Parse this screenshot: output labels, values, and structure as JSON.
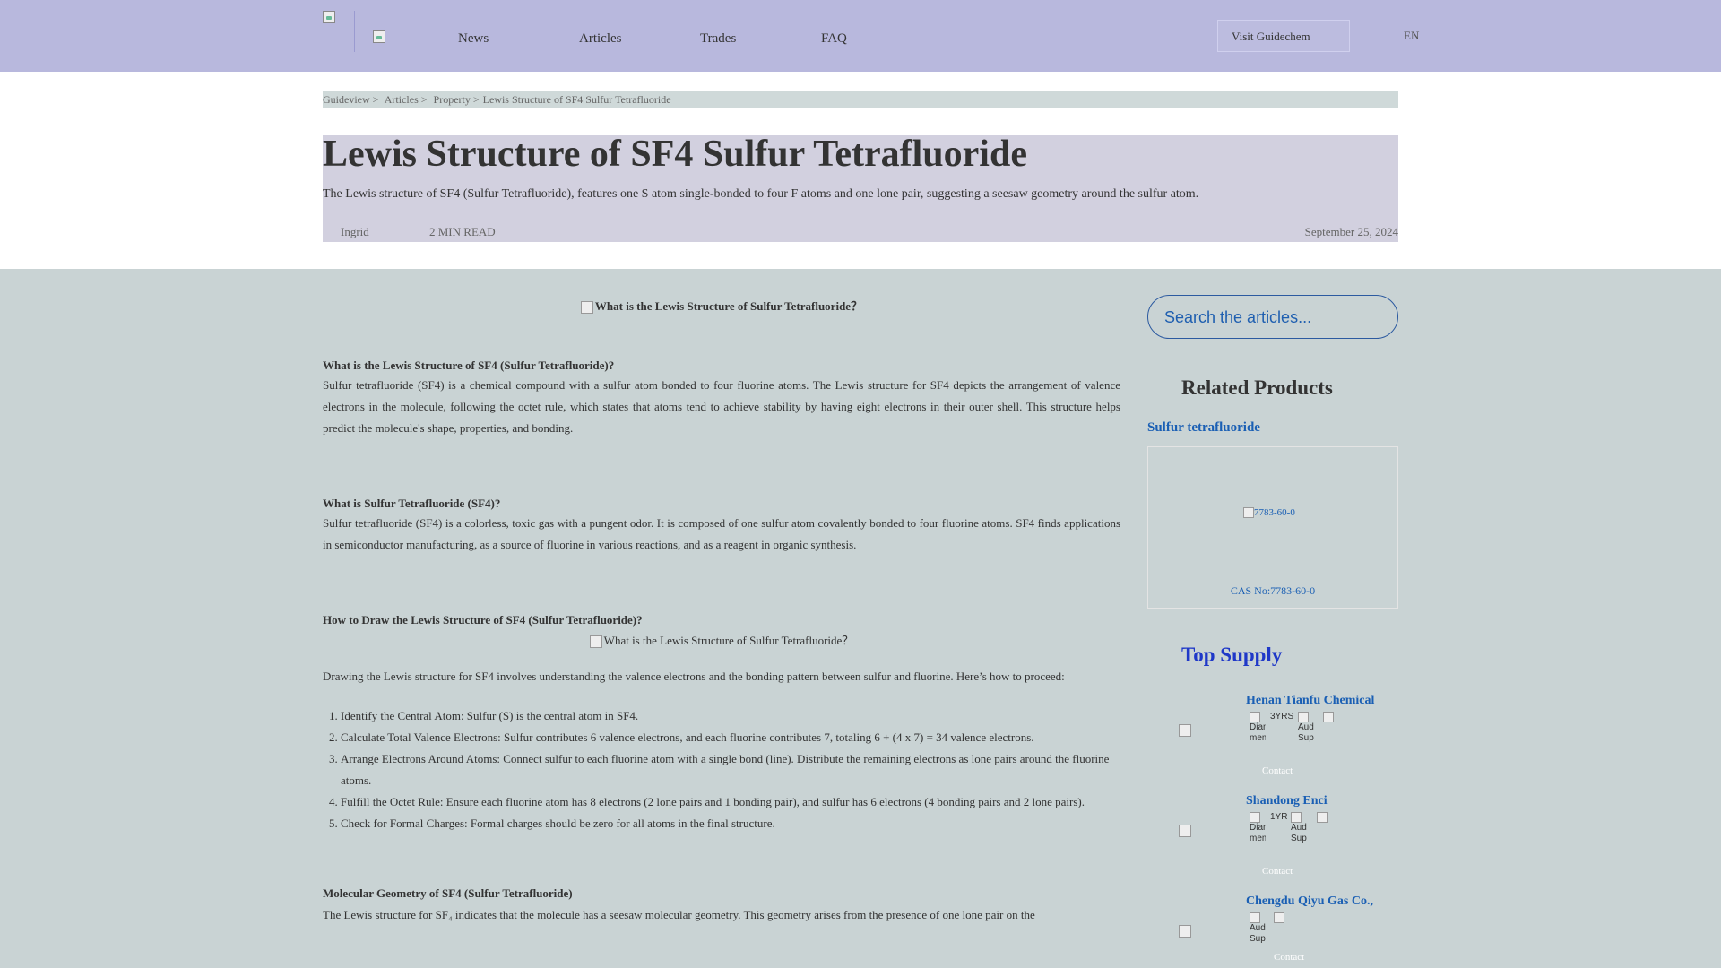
{
  "header": {
    "nav": [
      "News",
      "Articles",
      "Trades",
      "FAQ"
    ],
    "visit_label": "Visit Guidechem",
    "lang": "EN"
  },
  "breadcrumb": [
    "Guideview >",
    "Articles >",
    "Property >",
    "Lewis Structure of SF4 Sulfur Tetrafluoride"
  ],
  "article_head": {
    "title": "Lewis Structure of SF4 Sulfur Tetrafluoride",
    "summary": "The Lewis structure of SF4 (Sulfur Tetrafluoride), features one S atom single-bonded to four F atoms and one lone pair, suggesting a seesaw geometry around the sulfur atom.",
    "author": "Ingrid",
    "read_time": "2 MIN READ",
    "date": "September 25, 2024"
  },
  "article": {
    "img1_alt": "What is the Lewis Structure of Sulfur Tetrafluoride？",
    "s1_heading": "What is the Lewis Structure of SF4 (Sulfur Tetrafluoride)?",
    "s1_para": "Sulfur tetrafluoride (SF4) is a chemical compound with a sulfur atom bonded to four fluorine atoms. The Lewis structure for SF4 depicts the arrangement of valence electrons in the molecule, following the octet rule, which states that atoms tend to achieve stability by having eight electrons in their outer shell. This structure helps predict the molecule's shape, properties, and bonding.",
    "s2_heading": "What is Sulfur Tetrafluoride (SF4)?",
    "s2_para": "Sulfur tetrafluoride (SF4) is a colorless, toxic gas with a pungent odor. It is composed of one sulfur atom covalently bonded to four fluorine atoms. SF4 finds applications in semiconductor manufacturing, as a source of fluorine in various reactions, and as a reagent in organic synthesis.",
    "s3_heading": "How to Draw the Lewis Structure of SF4 (Sulfur Tetrafluoride)?",
    "img2_alt": "What is the Lewis Structure of Sulfur Tetrafluoride？",
    "s3_para": "Drawing the Lewis structure for SF4 involves understanding the valence electrons and the bonding pattern between sulfur and fluorine. Here’s how to proceed:",
    "steps": [
      "Identify the Central Atom: Sulfur (S) is the central atom in SF4.",
      "Calculate Total Valence Electrons: Sulfur contributes 6 valence electrons, and each fluorine contributes 7, totaling 6 + (4 x 7) = 34 valence electrons.",
      "Arrange Electrons Around Atoms: Connect sulfur to each fluorine atom with a single bond (line). Distribute the remaining electrons as lone pairs around the fluorine atoms.",
      "Fulfill the Octet Rule: Ensure each fluorine atom has 8 electrons (2 lone pairs and 1 bonding pair), and sulfur has 6 electrons (4 bonding pairs and 2 lone pairs).",
      "Check for Formal Charges: Formal charges should be zero for all atoms in the final structure."
    ],
    "s4_heading": "Molecular Geometry of SF4 (Sulfur Tetrafluoride)",
    "s4_para": "The Lewis structure for SF₄ indicates that the molecule has a seesaw molecular geometry. This geometry arises from the presence of one lone pair on the"
  },
  "sidebar": {
    "search_placeholder": "Search the articles...",
    "related_title": "Related Products",
    "product_name": "Sulfur tetrafluoride",
    "product_img_alt": "7783-60-0",
    "product_cas": "CAS No:7783-60-0",
    "top_supply_title": "Top Supply",
    "suppliers": [
      {
        "name": "Henan Tianfu Chemical",
        "years": "3YRS",
        "badge1": "Diamond member",
        "badge2": "Audited Supplier",
        "contact": "Contact"
      },
      {
        "name": "Shandong Enci",
        "years": "1YR",
        "badge1": "Diamond member",
        "badge2": "Audited Supplier",
        "contact": "Contact"
      },
      {
        "name": "Chengdu Qiyu Gas Co.,",
        "badge2": "Audited Supplier",
        "contact": "Contact"
      }
    ]
  }
}
